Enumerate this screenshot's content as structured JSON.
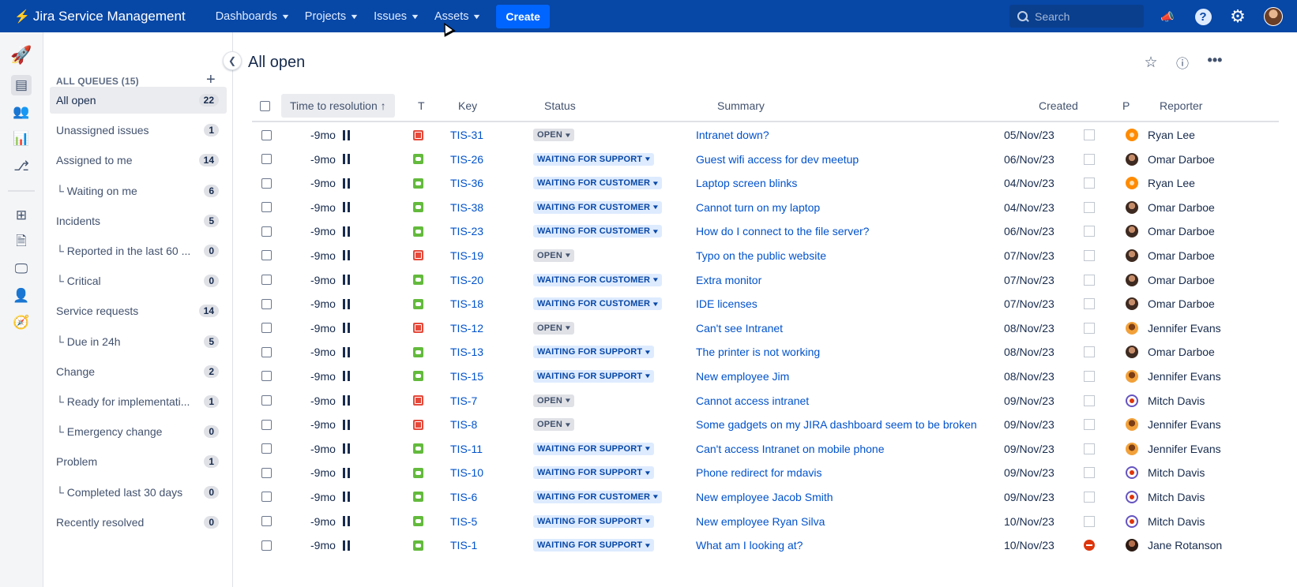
{
  "topnav": {
    "brand": "Jira Service Management",
    "items": [
      {
        "label": "Dashboards"
      },
      {
        "label": "Projects"
      },
      {
        "label": "Issues"
      },
      {
        "label": "Assets"
      }
    ],
    "create_label": "Create",
    "search_placeholder": "Search",
    "colors": {
      "bar": "#0747a6",
      "create": "#0065ff"
    }
  },
  "sidebar": {
    "header": "ALL QUEUES (15)",
    "items": [
      {
        "label": "All open",
        "count": "22",
        "active": true
      },
      {
        "label": "Unassigned issues",
        "count": "1"
      },
      {
        "label": "Assigned to me",
        "count": "14"
      },
      {
        "label": "└ Waiting on me",
        "count": "6"
      },
      {
        "label": "Incidents",
        "count": "5"
      },
      {
        "label": "└ Reported in the last 60 ...",
        "count": "0"
      },
      {
        "label": "└ Critical",
        "count": "0"
      },
      {
        "label": "Service requests",
        "count": "14"
      },
      {
        "label": "└ Due in 24h",
        "count": "5"
      },
      {
        "label": "Change",
        "count": "2"
      },
      {
        "label": "└ Ready for implementati...",
        "count": "1"
      },
      {
        "label": "└ Emergency change",
        "count": "0"
      },
      {
        "label": "Problem",
        "count": "1"
      },
      {
        "label": "└ Completed last 30 days",
        "count": "0"
      },
      {
        "label": "Recently resolved",
        "count": "0"
      }
    ]
  },
  "main": {
    "title": "All open",
    "columns": {
      "time": "Time to resolution ↑",
      "type": "T",
      "key": "Key",
      "status": "Status",
      "summary": "Summary",
      "created": "Created",
      "priority": "P",
      "reporter": "Reporter"
    },
    "rows": [
      {
        "time": "-9mo",
        "type": "incident",
        "key": "TIS-31",
        "status": "OPEN",
        "status_kind": "open",
        "summary": "Intranet down?",
        "created": "05/Nov/23",
        "p": "box",
        "reporter": "Ryan Lee",
        "avatar": "orange"
      },
      {
        "time": "-9mo",
        "type": "request",
        "key": "TIS-26",
        "status": "WAITING FOR SUPPORT",
        "status_kind": "waiting",
        "summary": "Guest wifi access for dev meetup",
        "created": "06/Nov/23",
        "p": "box",
        "reporter": "Omar Darboe",
        "avatar": "brown"
      },
      {
        "time": "-9mo",
        "type": "request",
        "key": "TIS-36",
        "status": "WAITING FOR CUSTOMER",
        "status_kind": "waiting",
        "summary": "Laptop screen blinks",
        "created": "04/Nov/23",
        "p": "box",
        "reporter": "Ryan Lee",
        "avatar": "orange"
      },
      {
        "time": "-9mo",
        "type": "request",
        "key": "TIS-38",
        "status": "WAITING FOR CUSTOMER",
        "status_kind": "waiting",
        "summary": "Cannot turn on my laptop",
        "created": "04/Nov/23",
        "p": "box",
        "reporter": "Omar Darboe",
        "avatar": "brown"
      },
      {
        "time": "-9mo",
        "type": "request",
        "key": "TIS-23",
        "status": "WAITING FOR CUSTOMER",
        "status_kind": "waiting",
        "summary": "How do I connect to the file server?",
        "created": "06/Nov/23",
        "p": "box",
        "reporter": "Omar Darboe",
        "avatar": "brown"
      },
      {
        "time": "-9mo",
        "type": "incident",
        "key": "TIS-19",
        "status": "OPEN",
        "status_kind": "open",
        "summary": "Typo on the public website",
        "created": "07/Nov/23",
        "p": "box",
        "reporter": "Omar Darboe",
        "avatar": "brown"
      },
      {
        "time": "-9mo",
        "type": "request",
        "key": "TIS-20",
        "status": "WAITING FOR CUSTOMER",
        "status_kind": "waiting",
        "summary": "Extra monitor",
        "created": "07/Nov/23",
        "p": "box",
        "reporter": "Omar Darboe",
        "avatar": "brown"
      },
      {
        "time": "-9mo",
        "type": "request",
        "key": "TIS-18",
        "status": "WAITING FOR CUSTOMER",
        "status_kind": "waiting",
        "summary": "IDE licenses",
        "created": "07/Nov/23",
        "p": "box",
        "reporter": "Omar Darboe",
        "avatar": "brown"
      },
      {
        "time": "-9mo",
        "type": "incident",
        "key": "TIS-12",
        "status": "OPEN",
        "status_kind": "open",
        "summary": "Can't see Intranet",
        "created": "08/Nov/23",
        "p": "box",
        "reporter": "Jennifer Evans",
        "avatar": "amber"
      },
      {
        "time": "-9mo",
        "type": "request",
        "key": "TIS-13",
        "status": "WAITING FOR SUPPORT",
        "status_kind": "waiting",
        "summary": "The printer is not working",
        "created": "08/Nov/23",
        "p": "box",
        "reporter": "Omar Darboe",
        "avatar": "brown"
      },
      {
        "time": "-9mo",
        "type": "request",
        "key": "TIS-15",
        "status": "WAITING FOR SUPPORT",
        "status_kind": "waiting",
        "summary": "New employee Jim",
        "created": "08/Nov/23",
        "p": "box",
        "reporter": "Jennifer Evans",
        "avatar": "amber"
      },
      {
        "time": "-9mo",
        "type": "incident",
        "key": "TIS-7",
        "status": "OPEN",
        "status_kind": "open",
        "summary": "Cannot access intranet",
        "created": "09/Nov/23",
        "p": "box",
        "reporter": "Mitch Davis",
        "avatar": "blue"
      },
      {
        "time": "-9mo",
        "type": "incident",
        "key": "TIS-8",
        "status": "OPEN",
        "status_kind": "open",
        "summary": "Some gadgets on my JIRA dashboard seem to be broken",
        "created": "09/Nov/23",
        "p": "box",
        "reporter": "Jennifer Evans",
        "avatar": "amber"
      },
      {
        "time": "-9mo",
        "type": "request",
        "key": "TIS-11",
        "status": "WAITING FOR SUPPORT",
        "status_kind": "waiting",
        "summary": "Can't access Intranet on mobile phone",
        "created": "09/Nov/23",
        "p": "box",
        "reporter": "Jennifer Evans",
        "avatar": "amber"
      },
      {
        "time": "-9mo",
        "type": "request",
        "key": "TIS-10",
        "status": "WAITING FOR SUPPORT",
        "status_kind": "waiting",
        "summary": "Phone redirect for mdavis",
        "created": "09/Nov/23",
        "p": "box",
        "reporter": "Mitch Davis",
        "avatar": "blue"
      },
      {
        "time": "-9mo",
        "type": "request",
        "key": "TIS-6",
        "status": "WAITING FOR CUSTOMER",
        "status_kind": "waiting",
        "summary": "New employee Jacob Smith",
        "created": "09/Nov/23",
        "p": "box",
        "reporter": "Mitch Davis",
        "avatar": "blue"
      },
      {
        "time": "-9mo",
        "type": "request",
        "key": "TIS-5",
        "status": "WAITING FOR SUPPORT",
        "status_kind": "waiting",
        "summary": "New employee Ryan Silva",
        "created": "10/Nov/23",
        "p": "box",
        "reporter": "Mitch Davis",
        "avatar": "blue"
      },
      {
        "time": "-9mo",
        "type": "request",
        "key": "TIS-1",
        "status": "WAITING FOR SUPPORT",
        "status_kind": "waiting",
        "summary": "What am I looking at?",
        "created": "10/Nov/23",
        "p": "blocker",
        "reporter": "Jane Rotanson",
        "avatar": "dark"
      }
    ]
  }
}
